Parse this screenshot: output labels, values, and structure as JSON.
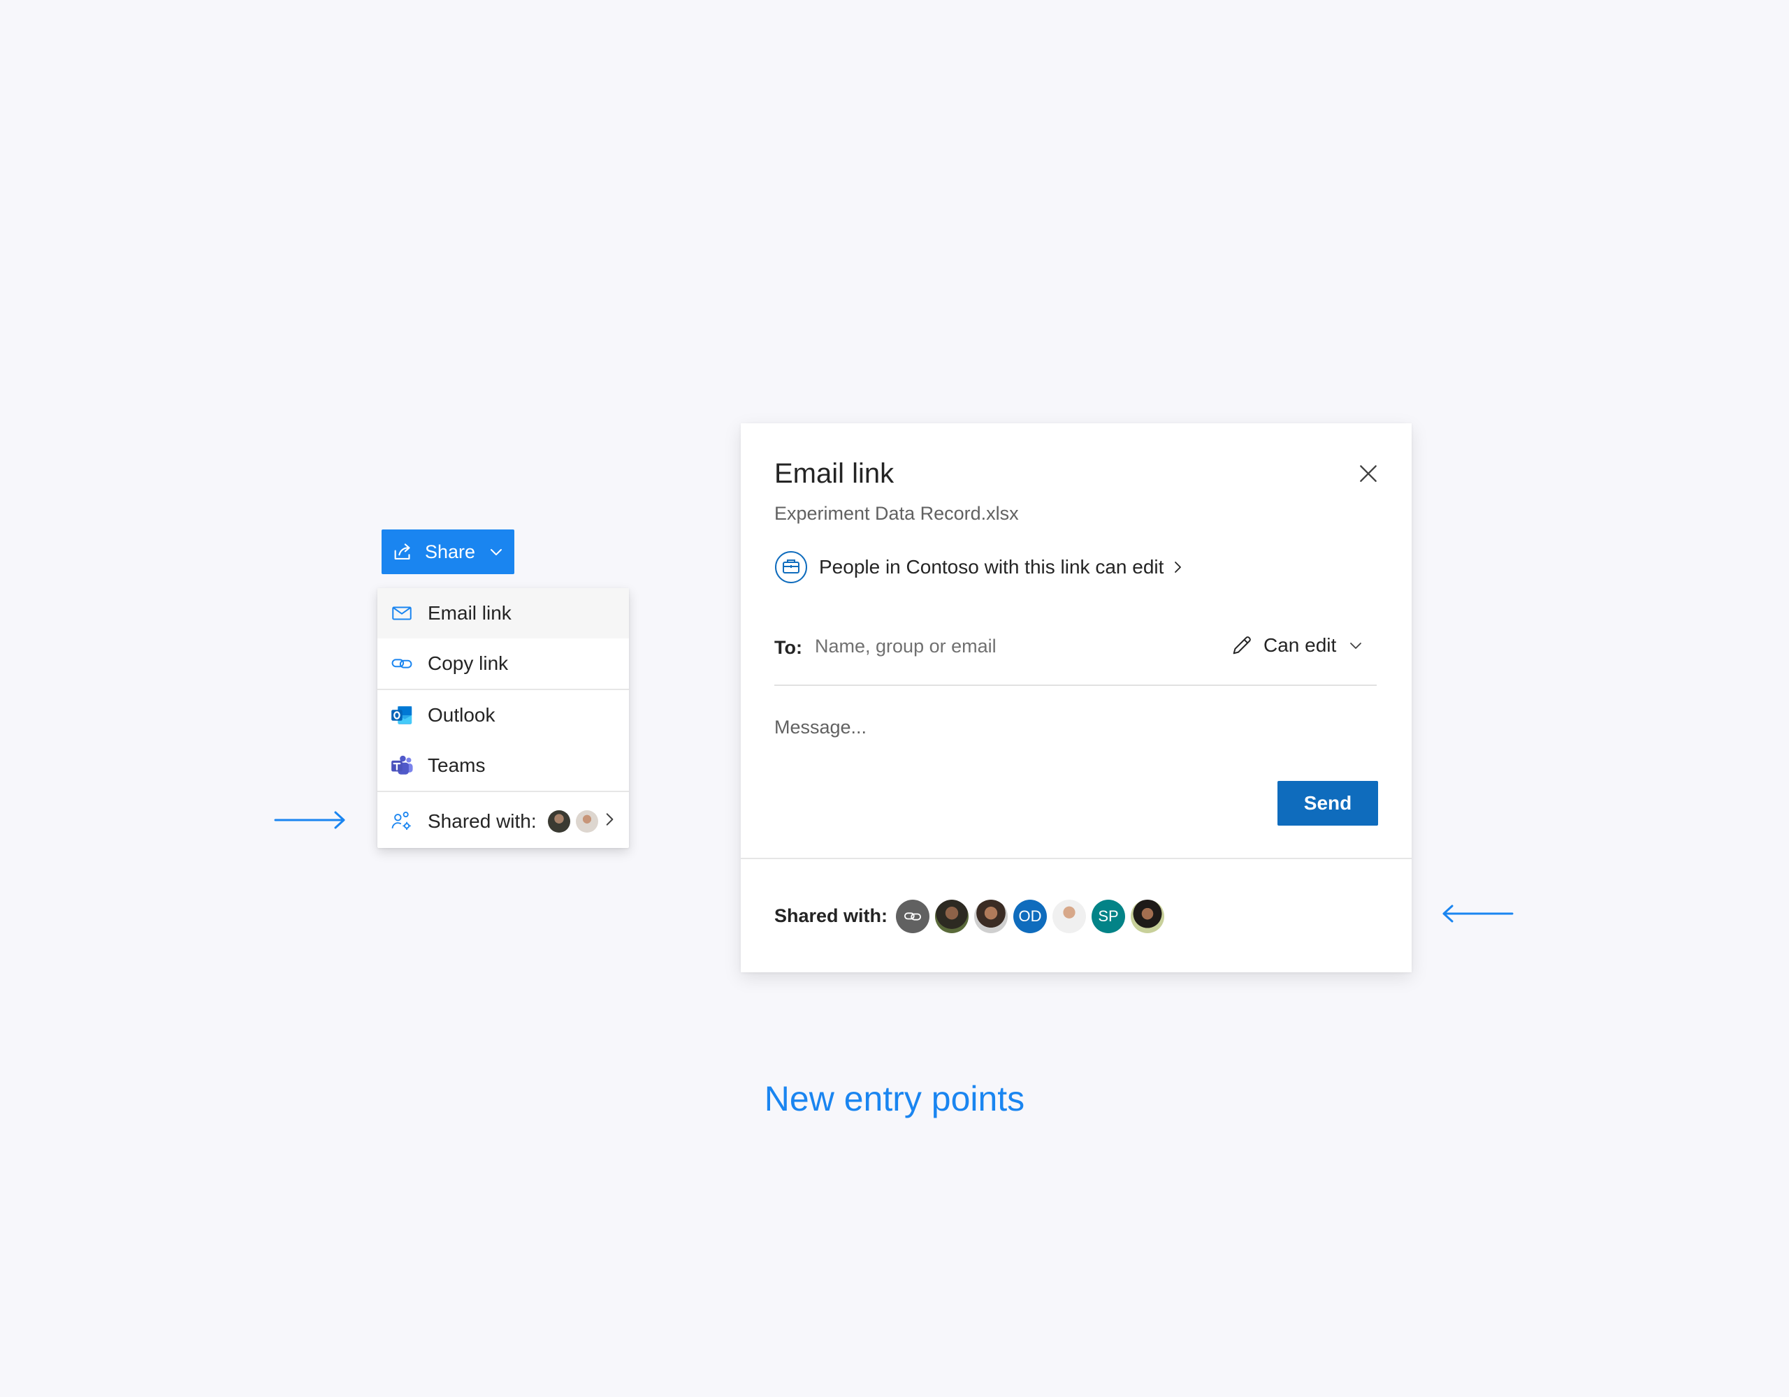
{
  "share_button": {
    "label": "Share"
  },
  "menu": {
    "items": [
      {
        "label": "Email link",
        "icon": "mail-icon"
      },
      {
        "label": "Copy link",
        "icon": "link-icon"
      },
      {
        "label": "Outlook",
        "icon": "outlook-icon"
      },
      {
        "label": "Teams",
        "icon": "teams-icon"
      }
    ],
    "shared_with_label": "Shared with:"
  },
  "dialog": {
    "title": "Email link",
    "file_name": "Experiment Data Record.xlsx",
    "permission_text": "People in Contoso with this link can edit",
    "to_label": "To:",
    "to_placeholder": "Name, group or email",
    "can_edit_label": "Can edit",
    "message_placeholder": "Message...",
    "send_label": "Send",
    "shared_with_label": "Shared with:",
    "avatars": [
      {
        "type": "link-icon",
        "text": ""
      },
      {
        "type": "photo",
        "text": ""
      },
      {
        "type": "photo",
        "text": ""
      },
      {
        "type": "initials",
        "text": "OD"
      },
      {
        "type": "photo",
        "text": ""
      },
      {
        "type": "initials",
        "text": "SP"
      },
      {
        "type": "photo",
        "text": ""
      }
    ]
  },
  "caption": "New entry points",
  "colors": {
    "accent": "#1a85f0",
    "send_button": "#0f6cbd",
    "avatar_od": "#0f6cbd",
    "avatar_sp": "#038387",
    "background": "#f7f7fb"
  }
}
